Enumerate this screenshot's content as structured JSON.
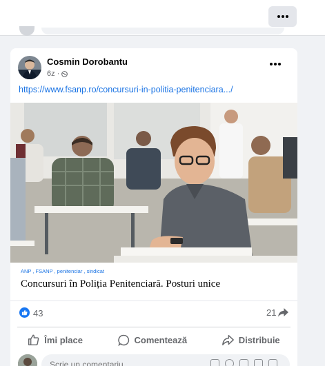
{
  "top_card": {
    "more_label": "More options"
  },
  "post": {
    "author": "Cosmin Dorobantu",
    "time": "6z",
    "separator": "·",
    "link": "https://www.fsanp.ro/concursuri-in-politia-penitenciara.../",
    "preview": {
      "tags": "ANP , FSANP , penitenciar , sindicat",
      "title": "Concursuri în Poliția Penitenciară. Posturi unice"
    },
    "likes": "43",
    "shares": "21",
    "actions": [
      {
        "label": "Îmi place",
        "icon": "thumbs-up-icon"
      },
      {
        "label": "Comentează",
        "icon": "comment-icon"
      },
      {
        "label": "Distribuie",
        "icon": "share-icon"
      }
    ],
    "comment_placeholder": "Scrie un comentariu..."
  },
  "colors": {
    "link": "#1b74e4",
    "like": "#1877f2",
    "muted": "#65676b",
    "background": "#f0f2f5"
  }
}
